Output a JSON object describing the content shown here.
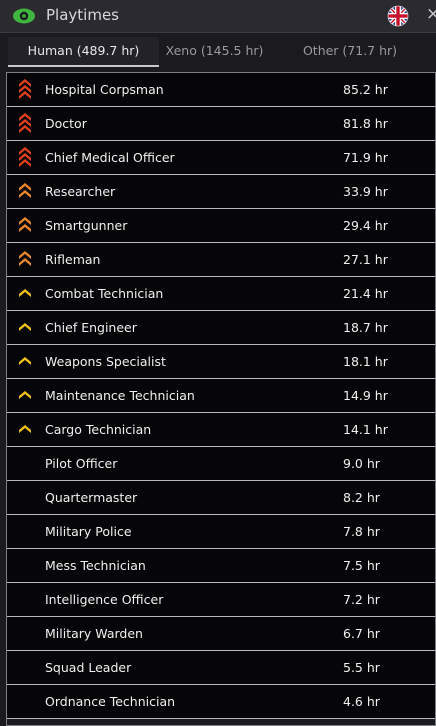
{
  "window": {
    "title": "Playtimes",
    "close_label": "×"
  },
  "tabs": [
    {
      "label": "Human (489.7 hr)",
      "active": true
    },
    {
      "label": "Xeno (145.5 hr)",
      "active": false
    },
    {
      "label": "Other (71.7 hr)",
      "active": false
    }
  ],
  "colors": {
    "rank_red": "#e0401e",
    "rank_orange": "#e8882a",
    "rank_yellow": "#f2c21b",
    "eye_green": "#3fb43f"
  },
  "rows": [
    {
      "name": "Hospital Corpsman",
      "hours": "85.2 hr",
      "icon": "chevron-stack-red-icon"
    },
    {
      "name": "Doctor",
      "hours": "81.8 hr",
      "icon": "chevron-stack-red-icon"
    },
    {
      "name": "Chief Medical Officer",
      "hours": "71.9 hr",
      "icon": "chevron-stack-red-icon"
    },
    {
      "name": "Researcher",
      "hours": "33.9 hr",
      "icon": "chevron-stack-orange-icon"
    },
    {
      "name": "Smartgunner",
      "hours": "29.4 hr",
      "icon": "chevron-stack-orange-icon"
    },
    {
      "name": "Rifleman",
      "hours": "27.1 hr",
      "icon": "chevron-stack-orange-icon"
    },
    {
      "name": "Combat Technician",
      "hours": "21.4 hr",
      "icon": "chevron-yellow-icon"
    },
    {
      "name": "Chief Engineer",
      "hours": "18.7 hr",
      "icon": "chevron-yellow-icon"
    },
    {
      "name": "Weapons Specialist",
      "hours": "18.1 hr",
      "icon": "chevron-yellow-icon"
    },
    {
      "name": "Maintenance Technician",
      "hours": "14.9 hr",
      "icon": "chevron-yellow-icon"
    },
    {
      "name": "Cargo Technician",
      "hours": "14.1 hr",
      "icon": "chevron-yellow-icon"
    },
    {
      "name": "Pilot Officer",
      "hours": "9.0 hr",
      "icon": ""
    },
    {
      "name": "Quartermaster",
      "hours": "8.2 hr",
      "icon": ""
    },
    {
      "name": "Military Police",
      "hours": "7.8 hr",
      "icon": ""
    },
    {
      "name": "Mess Technician",
      "hours": "7.5 hr",
      "icon": ""
    },
    {
      "name": "Intelligence Officer",
      "hours": "7.2 hr",
      "icon": ""
    },
    {
      "name": "Military Warden",
      "hours": "6.7 hr",
      "icon": ""
    },
    {
      "name": "Squad Leader",
      "hours": "5.5 hr",
      "icon": ""
    },
    {
      "name": "Ordnance Technician",
      "hours": "4.6 hr",
      "icon": ""
    }
  ]
}
